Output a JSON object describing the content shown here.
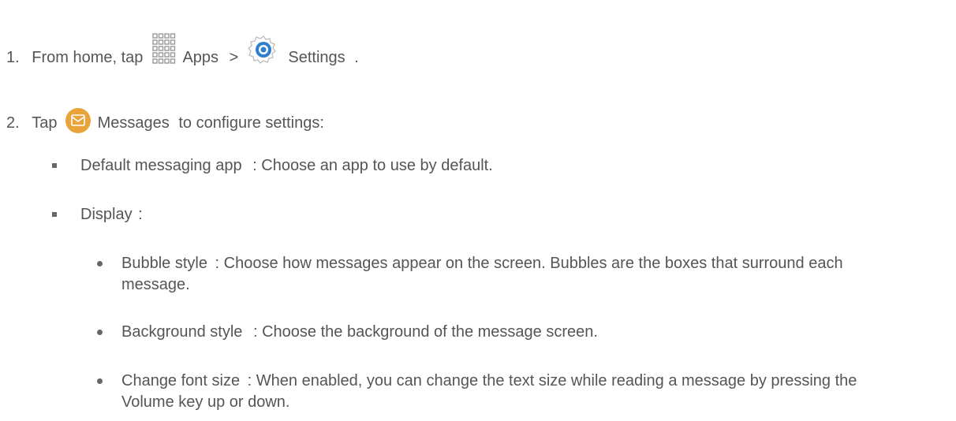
{
  "steps": [
    {
      "number": "1.",
      "before": "From home, tap",
      "apps_label": "Apps",
      "sep": ">",
      "settings_label": "Settings",
      "after": "."
    },
    {
      "number": "2.",
      "before": "Tap",
      "messages_label": "Messages",
      "after": "to configure settings:"
    }
  ],
  "options": [
    {
      "term": "Default messaging app",
      "desc": ": Choose an app to use by default."
    },
    {
      "term": "Display",
      "desc": ":"
    }
  ],
  "display_options": [
    {
      "term": "Bubble style",
      "desc": ": Choose how messages appear on the screen. Bubbles are the boxes that surround each message."
    },
    {
      "term": "Background style",
      "desc": ": Choose the background of the message screen."
    },
    {
      "term": "Change font size",
      "desc": ": When enabled, you can change the text size while reading a message by pressing the Volume key up or down."
    }
  ],
  "icons": {
    "apps": "apps-grid-icon",
    "settings": "settings-gear-icon",
    "messages": "messages-icon"
  },
  "colors": {
    "text": "#555555",
    "apps_icon": "#9a9a9a",
    "gear_blue": "#2f7fd0",
    "messages_orange": "#e8a33a"
  }
}
